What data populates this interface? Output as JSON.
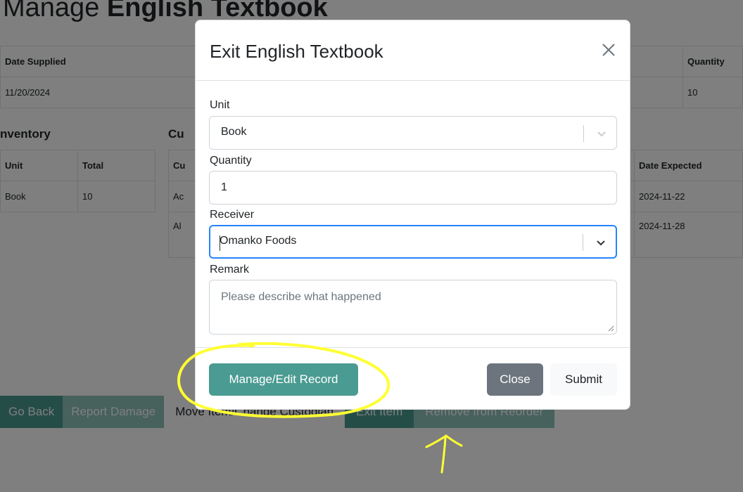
{
  "page": {
    "title_prefix": "Manage ",
    "title_bold": "English Textbook"
  },
  "supply_table": {
    "headers": [
      "Date Supplied",
      "Quantity"
    ],
    "row": [
      "11/20/2024",
      "10"
    ]
  },
  "inventory": {
    "heading": "nventory",
    "headers": [
      "Unit",
      "Total"
    ],
    "row": [
      "Book",
      "10"
    ]
  },
  "custody": {
    "heading": "Cu",
    "headers": [
      "Cu",
      "Date Expected"
    ],
    "rows": [
      [
        "Ac",
        "2024-11-22"
      ],
      [
        "Al",
        "2024-11-28"
      ]
    ]
  },
  "action_buttons": {
    "go_back": "Go Back",
    "report_damage": "Report Damage",
    "move_item": "Move Item/Change Custodian",
    "exit_item": "Exit Item",
    "remove_reorder": "Remove from Reorder"
  },
  "modal": {
    "title": "Exit English Textbook",
    "unit_label": "Unit",
    "unit_value": "Book",
    "quantity_label": "Quantity",
    "quantity_value": "1",
    "receiver_label": "Receiver",
    "receiver_value": "Omanko Foods",
    "remark_label": "Remark",
    "remark_placeholder": "Please describe what happened",
    "manage_button": "Manage/Edit Record",
    "close_button": "Close",
    "submit_button": "Submit"
  },
  "colors": {
    "teal": "#4a9b91",
    "teal_light": "#8fc2bb",
    "focus_blue": "#2684ff",
    "annotation_yellow": "#ffff33"
  }
}
